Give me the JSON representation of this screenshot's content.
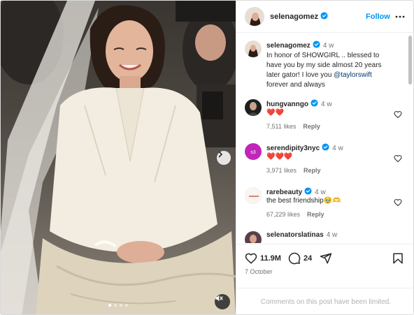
{
  "post": {
    "author": "selenagomez",
    "follow_label": "Follow",
    "date": "7 October"
  },
  "media": {
    "slide_count": 4,
    "active_slide": 0
  },
  "comments": [
    {
      "user": "selenagomez",
      "time": "4 w",
      "text": "In honor of SHOWGIRL .. blessed to have you by my side almost 20 years later gator! I love you",
      "mention": "@taylorswift",
      "text_after": "forever and always",
      "verified": true
    },
    {
      "user": "hungvanngo",
      "time": "4 w",
      "text": "❤️❤️",
      "likes": "7,511 likes",
      "reply": "Reply",
      "verified": true
    },
    {
      "user": "serendipity3nyc",
      "time": "4 w",
      "text": "❤️❤️❤️",
      "likes": "3,971 likes",
      "reply": "Reply",
      "verified": true
    },
    {
      "user": "rarebeauty",
      "time": "4 w",
      "text": "the best friendship🥹🫶",
      "likes": "67,229 likes",
      "reply": "Reply",
      "verified": true
    },
    {
      "user": "selenatorslatinas",
      "time": "4 w",
      "text": "",
      "verified": false
    }
  ],
  "actions": {
    "likes_count": "11.9M",
    "comments_count": "24"
  },
  "footer": {
    "limited_text": "Comments on this post have been limited."
  },
  "colors": {
    "accent": "#0095f6",
    "verified": "#0095f6",
    "mention": "#00376b",
    "muted": "#737373"
  },
  "icons": [
    "verified-badge-icon",
    "more-icon",
    "heart-icon",
    "comment-icon",
    "share-icon",
    "bookmark-icon",
    "chevron-right-icon",
    "mute-icon"
  ]
}
